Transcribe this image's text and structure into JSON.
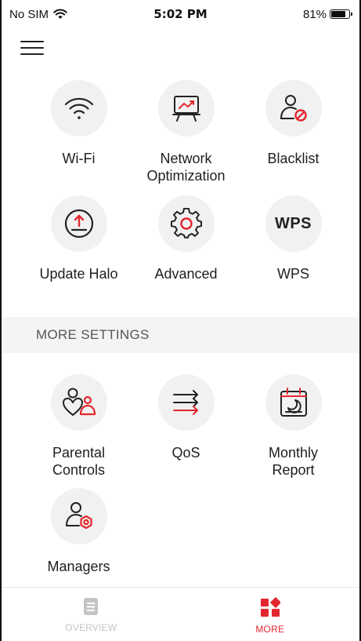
{
  "status_bar": {
    "carrier": "No SIM",
    "time": "5:02 PM",
    "battery": "81%",
    "battery_level": 0.81
  },
  "header": {
    "menu_icon": "hamburger-icon"
  },
  "main_tiles": [
    {
      "label": "Wi-Fi",
      "icon": "wifi-icon"
    },
    {
      "label": "Network Optimization",
      "icon": "network-optimization-icon"
    },
    {
      "label": "Blacklist",
      "icon": "blacklist-icon"
    },
    {
      "label": "Update Halo",
      "icon": "update-icon"
    },
    {
      "label": "Advanced",
      "icon": "gear-icon"
    },
    {
      "label": "WPS",
      "icon": "wps-icon",
      "icon_text": "WPS"
    }
  ],
  "more_settings": {
    "title": "MORE SETTINGS",
    "tiles": [
      {
        "label": "Parental Controls",
        "icon": "parental-controls-icon"
      },
      {
        "label": "QoS",
        "icon": "qos-icon"
      },
      {
        "label": "Monthly Report",
        "icon": "monthly-report-icon"
      },
      {
        "label": "Managers",
        "icon": "managers-icon"
      }
    ]
  },
  "tabbar": {
    "tabs": [
      {
        "label": "OVERVIEW",
        "icon": "overview-icon",
        "active": false
      },
      {
        "label": "MORE",
        "icon": "more-icon",
        "active": true
      }
    ]
  },
  "colors": {
    "accent": "#e3262d",
    "icon_bg": "#f1f1f1",
    "section_bg": "#f4f4f4",
    "inactive": "#c4c4c4"
  }
}
